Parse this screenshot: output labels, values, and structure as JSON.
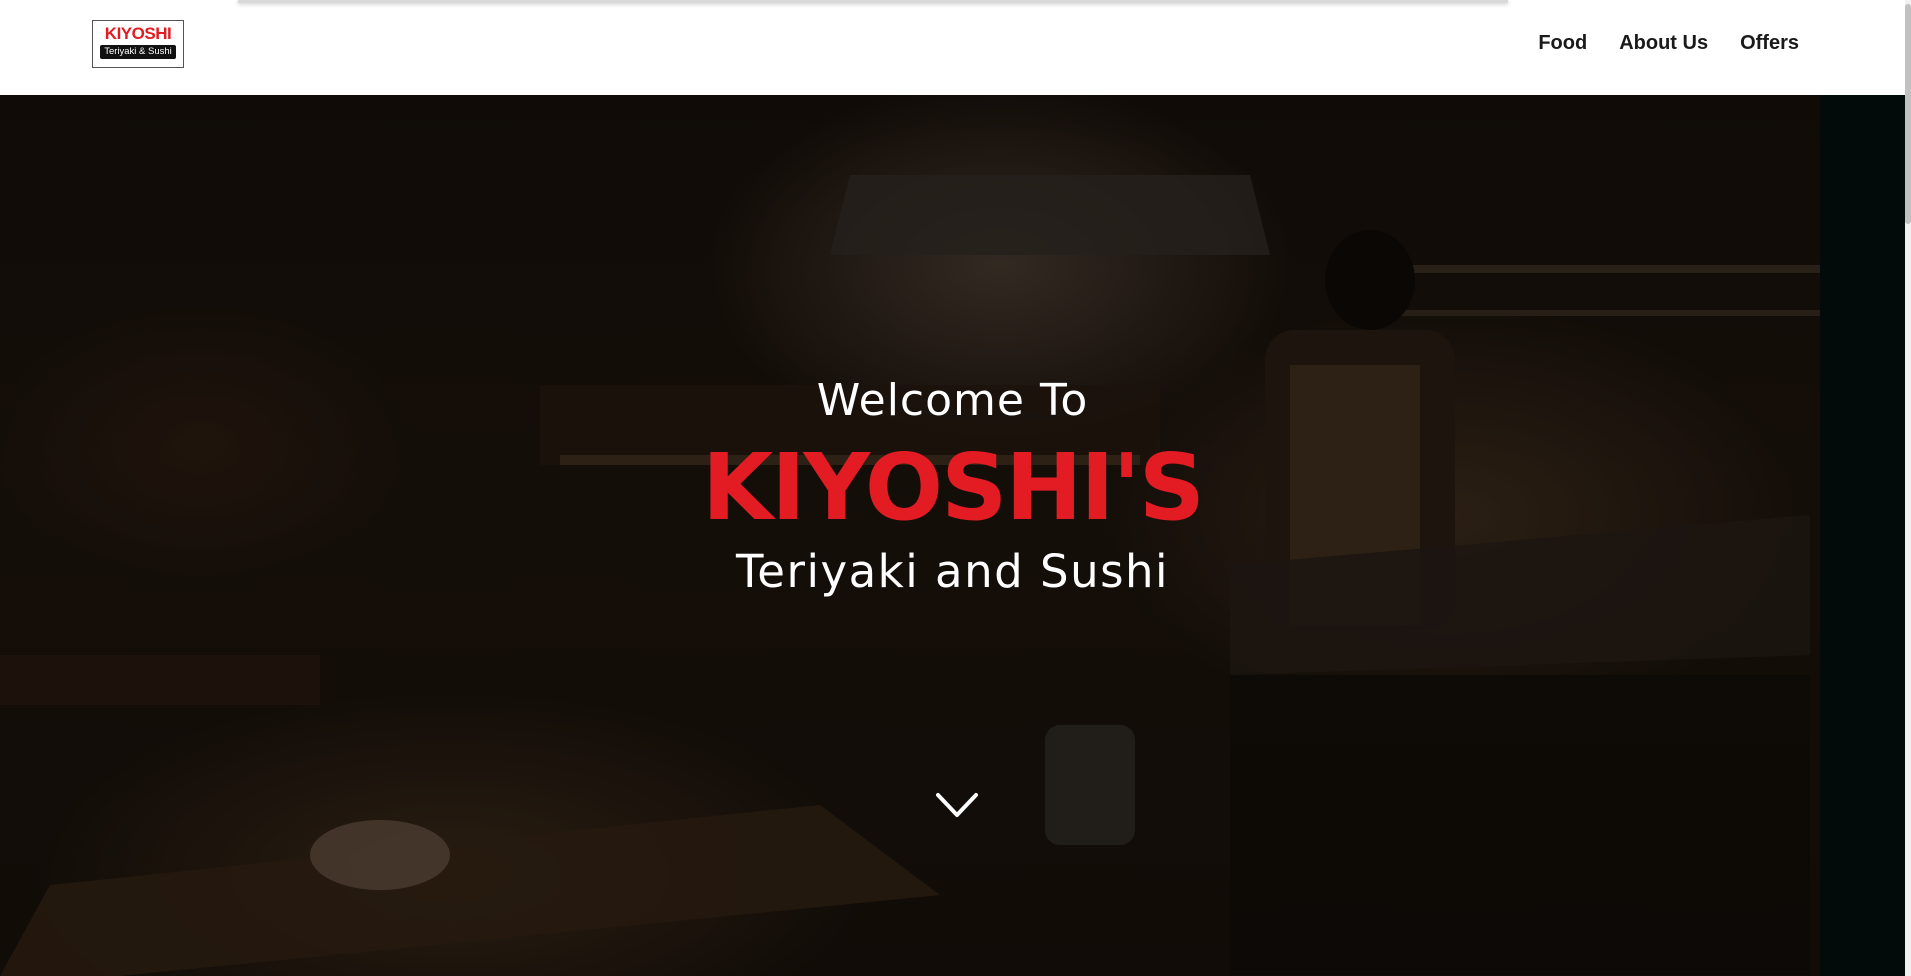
{
  "header": {
    "logo": {
      "main_text": "KIYOSHI",
      "sub_text": "Teriyaki & Sushi"
    },
    "nav": [
      {
        "label": "Food"
      },
      {
        "label": "About Us"
      },
      {
        "label": "Offers"
      }
    ]
  },
  "hero": {
    "welcome": "Welcome To",
    "brand": "KIYOSHI'S",
    "tagline": "Teriyaki and Sushi",
    "scroll_icon": "chevron-down-icon"
  },
  "colors": {
    "brand_red": "#e31b23",
    "nav_text": "#1a1a1a",
    "hero_text": "#ffffff"
  }
}
